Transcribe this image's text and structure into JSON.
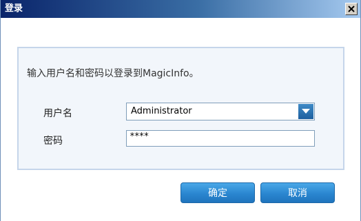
{
  "window": {
    "title": "登录",
    "close_icon": "close-icon"
  },
  "form": {
    "instruction": "输入用户名和密码以登录到MagicInfo。",
    "username_label": "用户名",
    "username_value": "Administrator",
    "dropdown_icon": "chevron-down-icon",
    "password_label": "密码",
    "password_value": "****"
  },
  "buttons": {
    "ok_label": "确定",
    "cancel_label": "取消"
  },
  "colors": {
    "titlebar_start": "#0a246a",
    "button_blue": "#2a86d0",
    "panel_border": "#c5d5ea"
  }
}
